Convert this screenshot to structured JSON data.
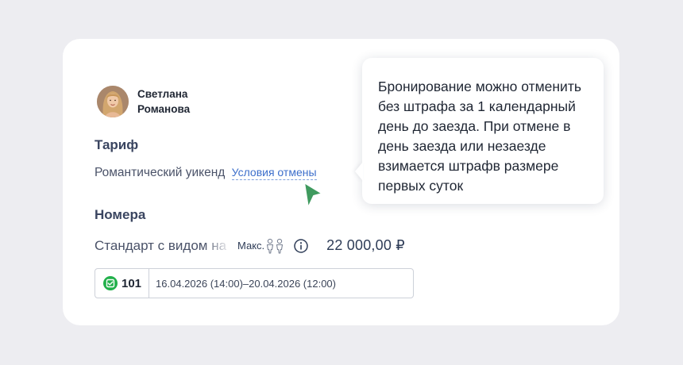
{
  "user": {
    "name": "Светлана\nРоманова"
  },
  "tariff": {
    "title": "Тариф",
    "name": "Романтический уикенд",
    "cancel_link": "Условия отмены"
  },
  "rooms": {
    "title": "Номера",
    "room_name": "Стандарт с видом на море",
    "max_label": "Макс.",
    "max_guests": 2,
    "price": "22 000,00 ₽"
  },
  "booking": {
    "room_number": "101",
    "dates": "16.04.2026 (14:00)–20.04.2026 (12:00)",
    "status": "selected"
  },
  "tooltip": {
    "text": "Бронирование можно отменить без штрафа за 1 календарный день до заезда. При отмене в день заезда или незаезде взимается штрафв размере первых суток"
  },
  "colors": {
    "background": "#ededf1",
    "card": "#ffffff",
    "link": "#3d6fcb",
    "cursor": "#3f9a5e",
    "check_green": "#22b04b"
  },
  "icons": {
    "avatar": "user-avatar",
    "guests": "person-icon",
    "info": "info-icon",
    "check": "check-square-icon",
    "cursor": "pointer-cursor-icon"
  }
}
